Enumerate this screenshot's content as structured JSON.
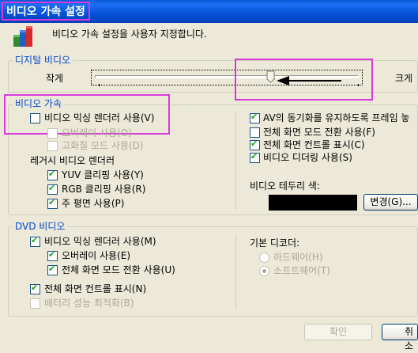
{
  "window": {
    "title": "비디오 가속 설정"
  },
  "header": {
    "description": "비디오 가속 설정을 사용자 지정합니다."
  },
  "digital_video": {
    "legend": "디지털 비디오",
    "min_label": "작게",
    "max_label": "크게"
  },
  "video_accel": {
    "legend": "비디오 가속",
    "mixing_renderer": {
      "label": "비디오 믹싱 렌더러 사용(V)",
      "checked": false
    },
    "overlay": {
      "label": "오버레이 사용(O)",
      "checked": false,
      "disabled": true
    },
    "hq_mode": {
      "label": "고화질 모드 사용(D)",
      "checked": false,
      "disabled": true
    },
    "legacy_heading": "레거시 비디오 렌더러",
    "yuv": {
      "label": "YUV 클리핑 사용(Y)",
      "checked": true
    },
    "rgb": {
      "label": "RGB 클리핑 사용(R)",
      "checked": true
    },
    "primary": {
      "label": "주 평면 사용(P)",
      "checked": true
    },
    "av_sync": {
      "label": "AV의 동기화를 유지하도록 프레임 놓",
      "checked": true
    },
    "fullscreen_switch": {
      "label": "전체 화면 모드 전환 사용(F)",
      "checked": false
    },
    "fullscreen_ctrl": {
      "label": "전체 화면 컨트롤 표시(C)",
      "checked": true
    },
    "video_dither": {
      "label": "비디오 디더링 사용(S)",
      "checked": true
    },
    "border_color_label": "비디오 테두리 색:",
    "border_color": "#000000",
    "change_button": "변경(G)..."
  },
  "dvd_video": {
    "legend": "DVD 비디오",
    "mixing_renderer": {
      "label": "비디오 믹싱 렌더러 사용(M)",
      "checked": true
    },
    "overlay": {
      "label": "오버레이 사용(E)",
      "checked": true
    },
    "fullscreen_switch": {
      "label": "전체 화면 모드 전환 사용(U)",
      "checked": true
    },
    "fullscreen_ctrl": {
      "label": "전체 화면 컨트롤 표시(N)",
      "checked": true
    },
    "battery": {
      "label": "배터리 성능 최적화(B)",
      "checked": false,
      "disabled": true
    },
    "decoder_heading": "기본 디코더:",
    "hardware": {
      "label": "하드웨어(H)",
      "selected": false
    },
    "software": {
      "label": "소프트웨어(T)",
      "selected": true
    }
  },
  "footer": {
    "ok": "확인",
    "cancel": "취소"
  }
}
